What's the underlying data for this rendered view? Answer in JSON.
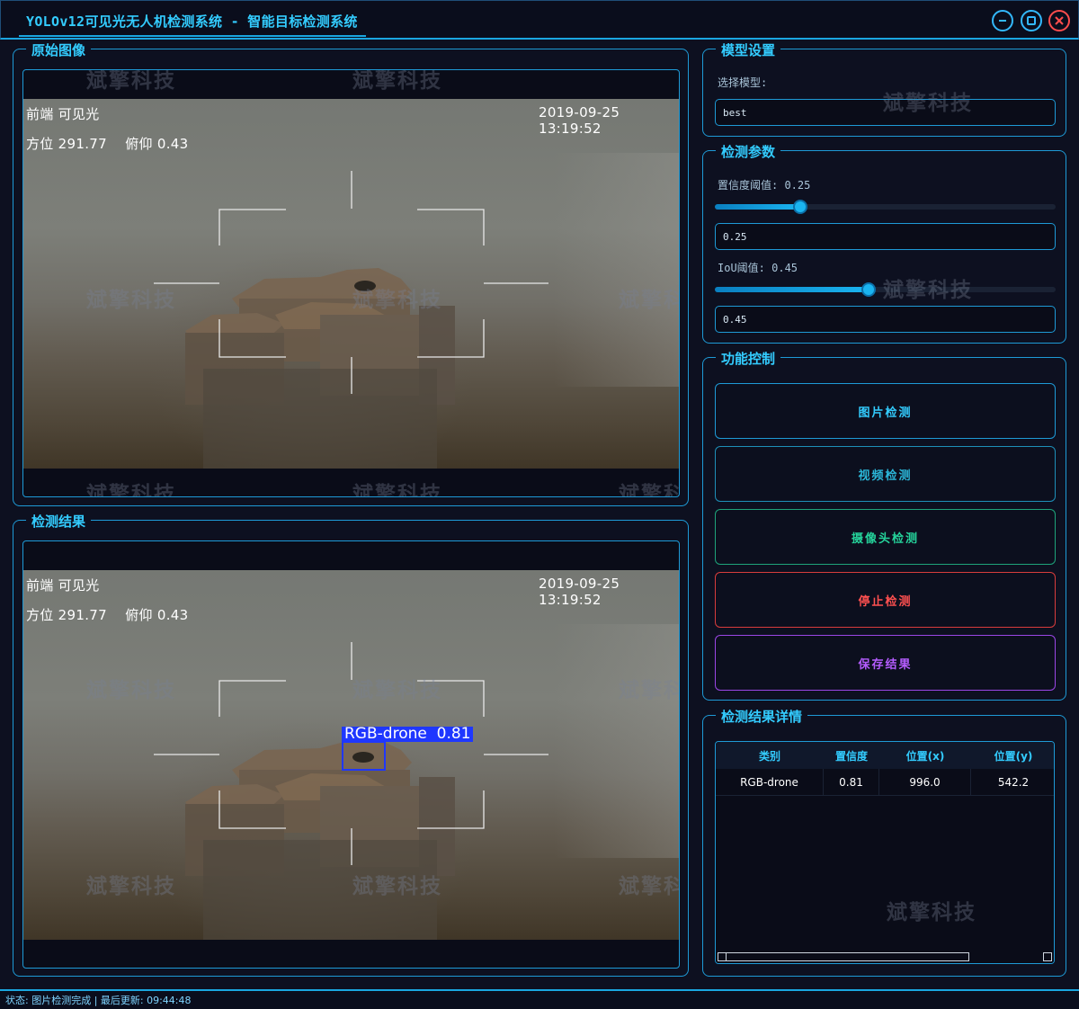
{
  "window": {
    "title": "YOLOv12可见光无人机检测系统 - 智能目标检测系统"
  },
  "panels": {
    "original_title": "原始图像",
    "result_title": "检测结果"
  },
  "overlay": {
    "front_label": "前端  可见光",
    "timestamp": "2019-09-25 13:19:52",
    "orientation": "方位 291.77    俯仰 0.43"
  },
  "watermark_text": "斌擎科技",
  "detection": {
    "box_label": "RGB-drone  0.81"
  },
  "model_settings": {
    "title": "模型设置",
    "select_label": "选择模型:",
    "model_value": "best"
  },
  "detect_params": {
    "title": "检测参数",
    "conf_label": "置信度阈值: 0.25",
    "conf_value": "0.25",
    "conf_level": 0.25,
    "iou_label": "IoU阈值: 0.45",
    "iou_value": "0.45",
    "iou_level": 0.45
  },
  "controls": {
    "title": "功能控制",
    "buttons": [
      {
        "label": "图片检测",
        "color": "#33ccff",
        "border": "#1e9ad6"
      },
      {
        "label": "视频检测",
        "color": "#2bb6d8",
        "border": "#1e8fb8"
      },
      {
        "label": "摄像头检测",
        "color": "#25d39b",
        "border": "#1ea37a"
      },
      {
        "label": "停止检测",
        "color": "#ff5050",
        "border": "#d83c3c"
      },
      {
        "label": "保存结果",
        "color": "#b45cff",
        "border": "#9b46e6"
      }
    ]
  },
  "results": {
    "title": "检测结果详情",
    "columns": [
      "类别",
      "置信度",
      "位置(x)",
      "位置(y)"
    ],
    "rows": [
      [
        "RGB-drone",
        "0.81",
        "996.0",
        "542.2"
      ]
    ]
  },
  "status": {
    "text": "状态: 图片检测完成 | 最后更新: 09:44:48"
  },
  "colors": {
    "accent": "#33ccff",
    "border": "#1e9ad6",
    "background": "#0d1020",
    "bbox": "#1f37ff"
  }
}
